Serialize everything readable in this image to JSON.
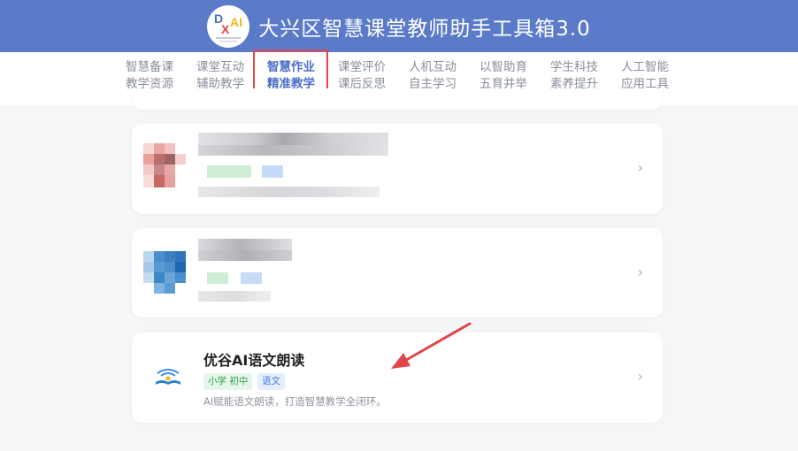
{
  "header": {
    "title": "大兴区智慧课堂教师助手工具箱3.0",
    "logo_text": "DXAI"
  },
  "nav": {
    "items": [
      {
        "line1": "智慧备课",
        "line2": "教学资源"
      },
      {
        "line1": "课堂互动",
        "line2": "辅助教学"
      },
      {
        "line1": "智慧作业",
        "line2": "精准教学",
        "active": true
      },
      {
        "line1": "课堂评价",
        "line2": "课后反思"
      },
      {
        "line1": "人机互动",
        "line2": "自主学习"
      },
      {
        "line1": "以智助育",
        "line2": "五育并举"
      },
      {
        "line1": "学生科技",
        "line2": "素养提升"
      },
      {
        "line1": "人工智能",
        "line2": "应用工具"
      }
    ]
  },
  "cards": [
    {
      "redacted": true
    },
    {
      "redacted": true
    },
    {
      "title": "优谷AI语文朗读",
      "tags": [
        "小学 初中",
        "语文"
      ],
      "description": "AI赋能语文朗读，打造智慧教学全闭环。",
      "icon": "reading-icon"
    }
  ],
  "colors": {
    "header_bg": "#5b7bc8",
    "active_nav": "#4a6fc6",
    "highlight_border": "#e0454a",
    "annotation_arrow": "#e0454a"
  }
}
